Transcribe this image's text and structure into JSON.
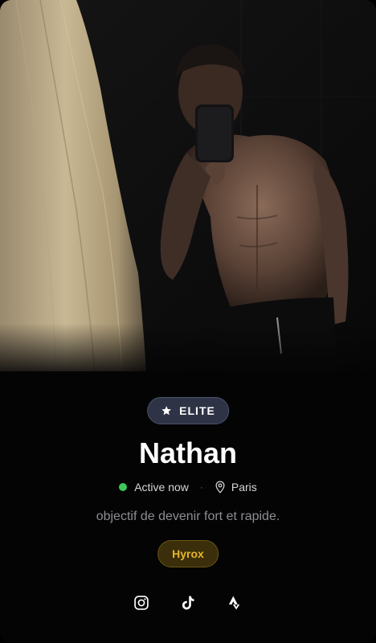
{
  "profile": {
    "photo": {
      "alt": "",
      "icon": "mirror-selfie-photo"
    },
    "badge": {
      "icon": "star-icon",
      "label": "ELITE"
    },
    "name": "Nathan",
    "status": {
      "label": "Active now",
      "color": "#3cc85a"
    },
    "location": {
      "icon": "map-pin-icon",
      "label": "Paris"
    },
    "separator": "·",
    "bio": "objectif de devenir fort et rapide.",
    "tags": [
      {
        "label": "Hyrox",
        "color": "#e6b52a"
      }
    ],
    "socials": [
      {
        "icon": "instagram-icon"
      },
      {
        "icon": "tiktok-icon"
      },
      {
        "icon": "strava-icon"
      }
    ]
  },
  "colors": {
    "background": "#040405",
    "badge_bg": "#2e3446",
    "tag_bg": "#3a2f0a",
    "tag_text": "#e6b52a",
    "muted_text": "#8d8d93"
  }
}
